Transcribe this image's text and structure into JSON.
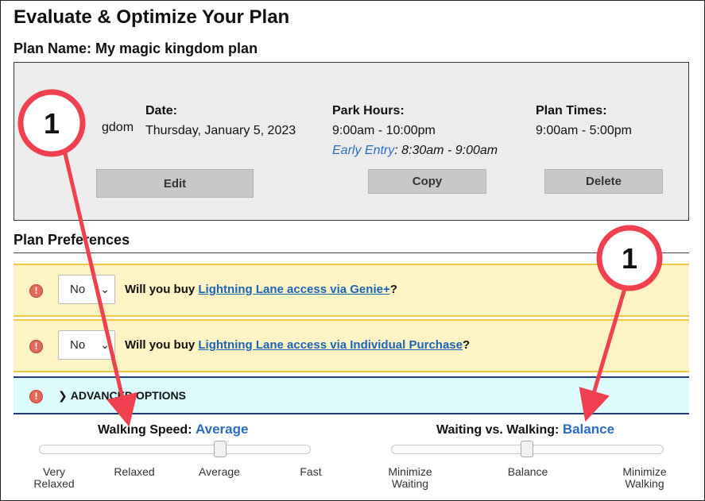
{
  "page": {
    "title": "Evaluate & Optimize Your Plan",
    "plan_name": "Plan Name: My magic kingdom plan"
  },
  "plan_box": {
    "park_name_partial": "gdom",
    "date_label": "Date:",
    "date_value": "Thursday, January 5, 2023",
    "hours_label": "Park Hours:",
    "hours_value": "9:00am - 10:00pm",
    "early_entry_label": "Early Entry",
    "early_entry_value": ": 8:30am - 9:00am",
    "times_label": "Plan Times:",
    "times_value": "9:00am - 5:00pm",
    "edit_label": "Edit",
    "copy_label": "Copy",
    "delete_label": "Delete"
  },
  "preferences": {
    "title": "Plan Preferences",
    "q1": {
      "selected": "No",
      "prefix": "Will you buy ",
      "link": "Lightning Lane access via Genie+",
      "suffix": "?"
    },
    "q2": {
      "selected": "No",
      "prefix": "Will you buy ",
      "link": "Lightning Lane access via Individual Purchase",
      "suffix": "?"
    },
    "advanced_label": "ADVANCED OPTIONS"
  },
  "sliders": {
    "walking_speed": {
      "label": "Walking Speed: ",
      "value": "Average",
      "ticks": [
        "Very Relaxed",
        "Relaxed",
        "Average",
        "Fast"
      ],
      "selected_index": 2
    },
    "waiting_walking": {
      "label": "Waiting vs. Walking: ",
      "value": "Balance",
      "ticks": [
        "Minimize Waiting",
        "Balance",
        "Minimize Walking"
      ],
      "selected_index": 1
    }
  },
  "annotations": {
    "callout_left": "1",
    "callout_right": "1",
    "arrow_color": "#f04050"
  },
  "colors": {
    "accent_blue": "#2a6cc0",
    "link_blue": "#1a64b8",
    "warning_yellow_bg": "#fdf3c3",
    "advanced_bg": "#dcfbfd"
  }
}
